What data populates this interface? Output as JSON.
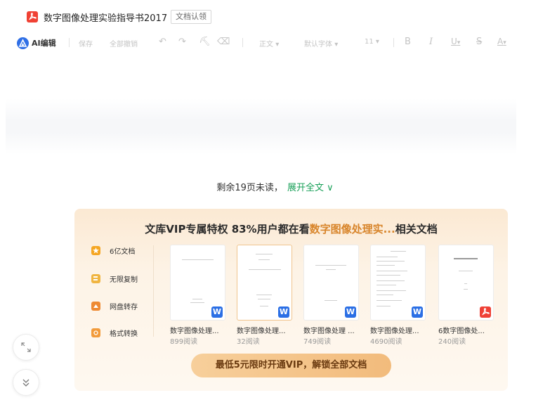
{
  "header": {
    "doc_title": "数字图像处理实验指导书2017",
    "auth_tag": "文档认领"
  },
  "toolbar": {
    "ai_label": "AI编辑",
    "save": "保存",
    "undo_all": "全部撤销",
    "style": "正文",
    "font": "默认字体",
    "size": "11",
    "bold": "B",
    "italic": "I",
    "underline": "U",
    "strike": "S",
    "fontcolor": "A",
    "dropdown_glyph": "▾"
  },
  "reader": {
    "remaining": "剩余19页未读，",
    "expand": "展开全文",
    "expand_glyph": "∨"
  },
  "vip": {
    "headline_prefix": "文库VIP专属特权 83%用户都在看",
    "headline_highlight": "数字图像处理实...",
    "headline_suffix": "相关文档",
    "features": [
      {
        "label": "6亿文档",
        "icon": "star-icon",
        "color": "#f5a623"
      },
      {
        "label": "无限复制",
        "icon": "copy-icon",
        "color": "#f0b541"
      },
      {
        "label": "网盘转存",
        "icon": "cloud-icon",
        "color": "#ee8a32"
      },
      {
        "label": "格式转换",
        "icon": "convert-icon",
        "color": "#f29b3b"
      }
    ],
    "docs": [
      {
        "title": "数字图像处理...",
        "reads": "899阅读",
        "badge": "W",
        "type": "word"
      },
      {
        "title": "数字图像处理...",
        "reads": "32阅读",
        "badge": "W",
        "type": "word"
      },
      {
        "title": "数字图像处理 ...",
        "reads": "749阅读",
        "badge": "W",
        "type": "word"
      },
      {
        "title": "数字图像处理...",
        "reads": "4690阅读",
        "badge": "W",
        "type": "word"
      },
      {
        "title": "6数字图像处...",
        "reads": "240阅读",
        "badge": "",
        "type": "pdf"
      }
    ],
    "cta": "最低5元限时开通VIP，解锁全部文档"
  },
  "colors": {
    "accent_green": "#18a058",
    "vip_gold": "#d8852b",
    "word_blue": "#2b6fe5",
    "pdf_red": "#ef4136"
  }
}
